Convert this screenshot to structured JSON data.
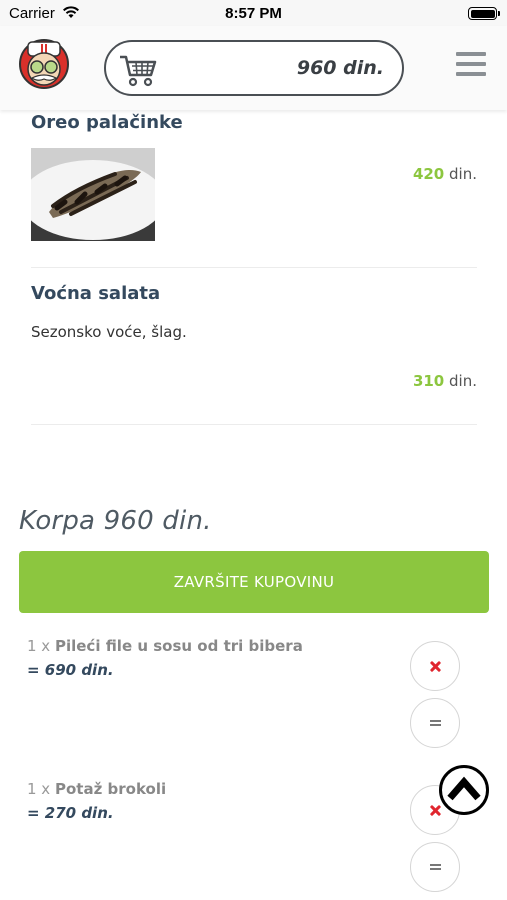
{
  "status_bar": {
    "carrier": "Carrier",
    "time": "8:57 PM"
  },
  "header": {
    "cart_total": "960 din."
  },
  "products": [
    {
      "title": "Oreo palačinke",
      "price_amount": "420",
      "price_currency": "din."
    },
    {
      "title": "Voćna salata",
      "description": "Sezonsko voće, šlag.",
      "price_amount": "310",
      "price_currency": "din."
    }
  ],
  "cart": {
    "heading": "Korpa 960 din.",
    "checkout_label": "ZAVRŠITE KUPOVINU",
    "items": [
      {
        "qty": "1 x",
        "name": "Pileći file u sosu od tri bibera",
        "sum": "= 690 din."
      },
      {
        "qty": "1 x",
        "name": "Potaž brokoli",
        "sum": "= 270 din."
      }
    ]
  },
  "colors": {
    "accent": "#8cc63f",
    "remove": "#e0262f",
    "title": "#34495e"
  }
}
